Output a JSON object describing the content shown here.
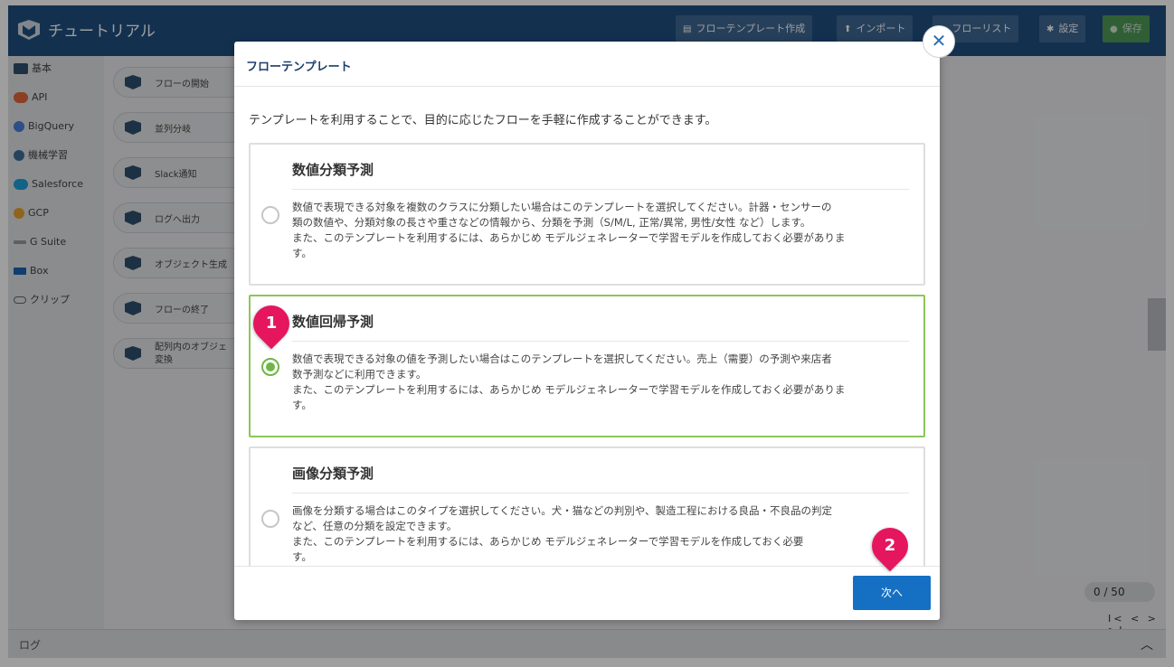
{
  "app": {
    "title": "チュートリアル",
    "toolbar": {
      "create_template": "フローテンプレート作成",
      "import": "インポート",
      "flow_list": "フローリスト",
      "settings": "設定",
      "save": "保存"
    }
  },
  "sidebar": {
    "items": [
      {
        "label": "基本",
        "icon": "flow-logo-icon",
        "color": "#2f4f6f"
      },
      {
        "label": "API",
        "icon": "cloud-icon",
        "color": "#e0663a"
      },
      {
        "label": "BigQuery",
        "icon": "bigquery-icon",
        "color": "#4a7fd8"
      },
      {
        "label": "機械学習",
        "icon": "brain-icon",
        "color": "#3f6e97"
      },
      {
        "label": "Salesforce",
        "icon": "salesforce-cloud-icon",
        "color": "#1ea0d8"
      },
      {
        "label": "GCP",
        "icon": "gcp-icon",
        "color": "#e6a32c"
      },
      {
        "label": "G Suite",
        "icon": "gsuite-icon",
        "color": "#777777"
      },
      {
        "label": "Box",
        "icon": "box-icon",
        "color": "#1b64b3"
      },
      {
        "label": "クリップ",
        "icon": "clip-icon",
        "color": "#666666"
      }
    ]
  },
  "palette": {
    "nodes": [
      {
        "label": "フローの開始"
      },
      {
        "label": "並列分岐"
      },
      {
        "label": "Slack通知"
      },
      {
        "label": "ログへ出力"
      },
      {
        "label": "オブジェクト生成"
      },
      {
        "label": "フローの終了"
      },
      {
        "label": "配列内のオブジェ 変換"
      }
    ]
  },
  "log": {
    "label": "ログ"
  },
  "counter": {
    "value": "0 / 50"
  },
  "pager": {
    "label": "I< < > >I"
  },
  "modal": {
    "title": "フローテンプレート",
    "intro": "テンプレートを利用することで、目的に応じたフローを手軽に作成することができます。",
    "options": [
      {
        "title": "数値分類予測",
        "selected": false,
        "lines": [
          "数値で表現できる対象を複数のクラスに分類したい場合はこのテンプレートを選択してください。計器・センサーの",
          "類の数値や、分類対象の長さや重さなどの情報から、分類を予測（S/M/L, 正常/異常, 男性/女性 など）します。",
          "また、このテンプレートを利用するには、あらかじめ モデルジェネレーターで学習モデルを作成しておく必要がありま",
          "す。"
        ]
      },
      {
        "title": "数値回帰予測",
        "selected": true,
        "lines": [
          "数値で表現できる対象の値を予測したい場合はこのテンプレートを選択してください。売上（需要）の予測や来店者",
          "数予測などに利用できます。",
          "また、このテンプレートを利用するには、あらかじめ モデルジェネレーターで学習モデルを作成しておく必要がありま",
          "す。"
        ]
      },
      {
        "title": "画像分類予測",
        "selected": false,
        "lines": [
          "画像を分類する場合はこのタイプを選択してください。犬・猫などの判別や、製造工程における良品・不良品の判定",
          "など、任意の分類を設定できます。",
          "また、このテンプレートを利用するには、あらかじめ モデルジェネレーターで学習モデルを作成しておく必要",
          "す。"
        ]
      }
    ],
    "next_label": "次へ"
  },
  "markers": [
    {
      "number": "1"
    },
    {
      "number": "2"
    }
  ],
  "colors": {
    "topbar": "#1f4f80",
    "selected_border": "#8cc65a",
    "primary_button": "#1570c3",
    "marker": "#e5165e"
  }
}
